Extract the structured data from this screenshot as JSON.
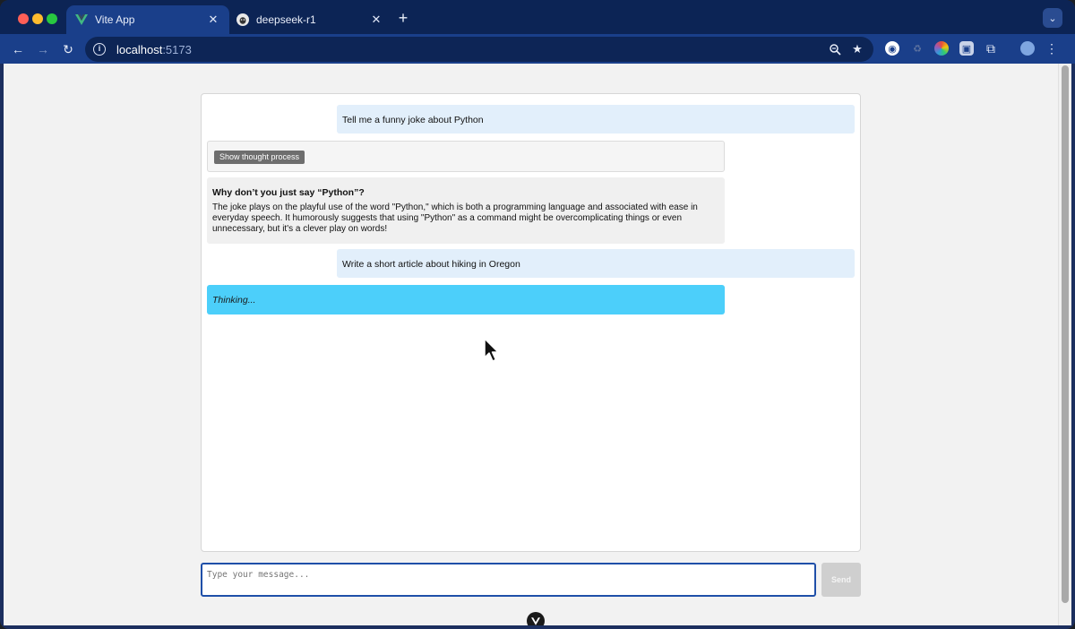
{
  "browser": {
    "tabs": [
      {
        "title": "Vite App",
        "favicon": "vue-logo-icon",
        "active": true
      },
      {
        "title": "deepseek-r1",
        "favicon": "ollama-logo-icon",
        "active": false
      }
    ],
    "address": {
      "host": "localhost",
      "port": ":5173"
    }
  },
  "chat": {
    "messages": {
      "user_1": "Tell me a funny joke about Python",
      "thought_toggle_label": "Show thought process",
      "assistant_heading": "Why don’t you just say “Python”?",
      "assistant_body": "The joke plays on the playful use of the word \"Python,\" which is both a programming language and associated with ease in everyday speech. It humorously suggests that using \"Python\" as a command might be overcomplicating things or even unnecessary, but it's a clever play on words!",
      "user_2": "Write a short article about hiking in Oregon",
      "thinking": "Thinking..."
    }
  },
  "composer": {
    "placeholder": "Type your message...",
    "send_label": "Send"
  },
  "colors": {
    "user_bubble": "#e2effb",
    "thinking_bubble": "#4ccffa",
    "input_border": "#1f4fa8"
  }
}
